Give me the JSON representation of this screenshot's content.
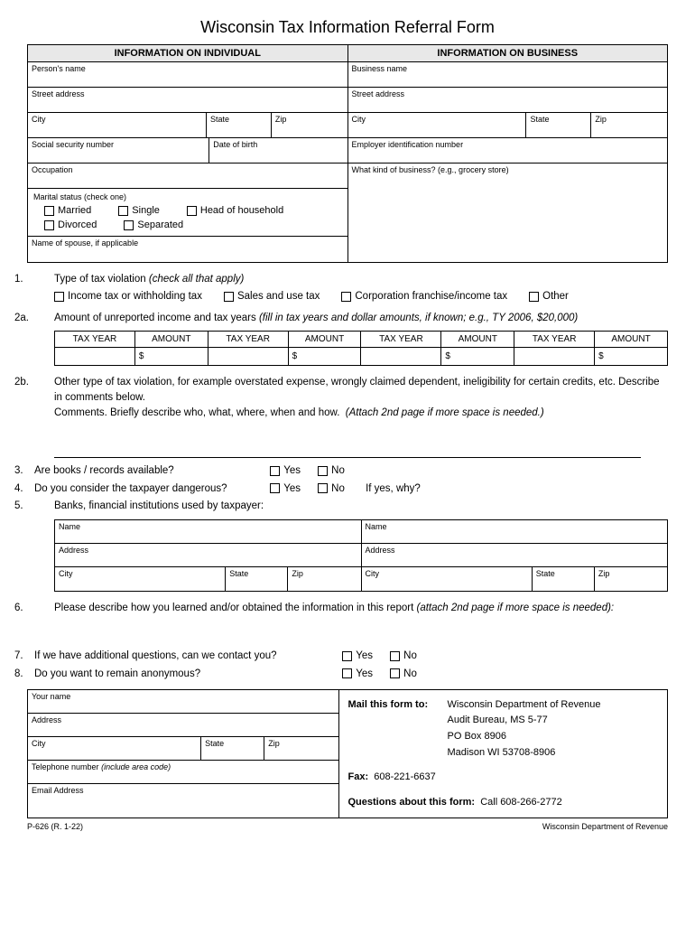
{
  "title": "Wisconsin Tax Information Referral Form",
  "headers": {
    "individual": "INFORMATION ON INDIVIDUAL",
    "business": "INFORMATION ON BUSINESS"
  },
  "ind": {
    "name": "Person's name",
    "street": "Street address",
    "city": "City",
    "state": "State",
    "zip": "Zip",
    "ssn": "Social security number",
    "dob": "Date of birth",
    "occupation": "Occupation",
    "marital_lbl": "Marital status (check one)",
    "married": "Married",
    "single": "Single",
    "hoh": "Head of household",
    "divorced": "Divorced",
    "separated": "Separated",
    "spouse": "Name of spouse, if applicable"
  },
  "bus": {
    "name": "Business name",
    "street": "Street address",
    "city": "City",
    "state": "State",
    "zip": "Zip",
    "ein": "Employer identification number",
    "kind": "What kind of business? (e.g., grocery store)"
  },
  "q1": {
    "num": "1.",
    "text": "Type of tax violation",
    "hint": "(check all that apply)",
    "opt1": "Income tax or withholding tax",
    "opt2": "Sales and use tax",
    "opt3": "Corporation franchise/income tax",
    "opt4": "Other"
  },
  "q2a": {
    "num": "2a.",
    "text": "Amount of unreported income and tax years",
    "hint": "(fill in tax years and dollar amounts, if known; e.g., TY 2006, $20,000)",
    "th_year": "TAX YEAR",
    "th_amt": "AMOUNT",
    "dollar": "$"
  },
  "q2b": {
    "num": "2b.",
    "text": "Other type of tax violation, for example overstated expense, wrongly claimed dependent, ineligibility for certain credits, etc.  Describe in comments below.",
    "comments": "Comments.  Briefly describe who, what, where, when and how.",
    "hint": "(Attach 2nd page if more space is needed.)"
  },
  "q3": {
    "num": "3.",
    "text": "Are books / records available?"
  },
  "q4": {
    "num": "4.",
    "text": "Do you consider the taxpayer dangerous?",
    "ifyes": "If yes, why?"
  },
  "q5": {
    "num": "5.",
    "text": "Banks, financial institutions used by taxpayer:",
    "name": "Name",
    "address": "Address",
    "city": "City",
    "state": "State",
    "zip": "Zip"
  },
  "q6": {
    "num": "6.",
    "text": "Please describe how you learned and/or obtained the information in this report",
    "hint": "(attach 2nd page if more space is needed):"
  },
  "q7": {
    "num": "7.",
    "text": "If we have additional questions, can we contact you?"
  },
  "q8": {
    "num": "8.",
    "text": "Do you want to remain anonymous?"
  },
  "yn": {
    "yes": "Yes",
    "no": "No"
  },
  "you": {
    "name": "Your name",
    "address": "Address",
    "city": "City",
    "state": "State",
    "zip": "Zip",
    "phone": "Telephone number",
    "phone_hint": "(include area code)",
    "email": "Email Address"
  },
  "mail": {
    "lbl": "Mail this form to:",
    "l1": "Wisconsin Department of Revenue",
    "l2": "Audit Bureau, MS 5-77",
    "l3": "PO Box 8906",
    "l4": "Madison WI  53708-8906",
    "fax_lbl": "Fax:",
    "fax": "608-221-6637",
    "q_lbl": "Questions about this form:",
    "q_val": "Call 608-266-2772"
  },
  "footer": {
    "left": "P-626 (R. 1-22)",
    "right": "Wisconsin Department of Revenue"
  }
}
